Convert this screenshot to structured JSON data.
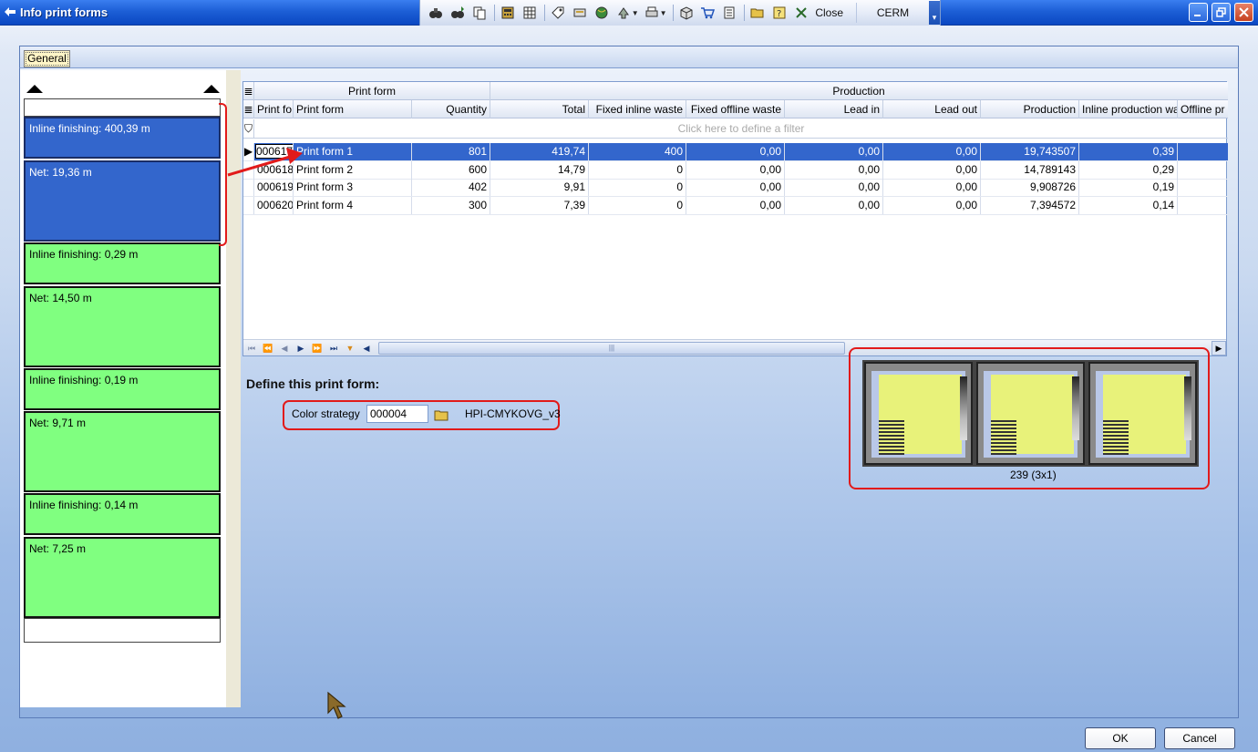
{
  "window": {
    "title": "Info print forms",
    "close_label": "Close",
    "cerm_label": "CERM"
  },
  "toolbar_icons": [
    "binoculars-icon",
    "find-next-icon",
    "copy-icon",
    "calculator-icon",
    "grid-icon",
    "tag-icon",
    "scanner-icon",
    "globe-icon",
    "export-icon",
    "print-icon",
    "box-icon",
    "cart-icon",
    "book-icon",
    "open-folder-icon",
    "help-icon",
    "close-icon"
  ],
  "tabs": [
    {
      "label": "General"
    }
  ],
  "left_panel": {
    "segments": [
      {
        "inline": "Inline finishing: 400,39 m",
        "net": "Net: 19,36 m",
        "color": "#3366cc"
      },
      {
        "inline": "Inline finishing: 0,29 m",
        "net": "Net: 14,50 m",
        "color": "#80ff80"
      },
      {
        "inline": "Inline finishing: 0,19 m",
        "net": "Net: 9,71 m",
        "color": "#80ff80"
      },
      {
        "inline": "Inline finishing: 0,14 m",
        "net": "Net: 7,25 m",
        "color": "#80ff80"
      }
    ]
  },
  "grid": {
    "bands": {
      "print_form": "Print form",
      "production": "Production"
    },
    "columns": [
      "Print fo",
      "Print form",
      "Quantity",
      "Total",
      "Fixed inline waste",
      "Fixed offline waste",
      "Lead in",
      "Lead out",
      "Production",
      "Inline production wa",
      "Offline pr"
    ],
    "filter_hint": "Click here to define a filter",
    "rows": [
      {
        "id": "000617",
        "name": "Print form 1",
        "quantity": "801",
        "total": "419,74",
        "fixed_inline": "400",
        "fixed_offline": "0,00",
        "lead_in": "0,00",
        "lead_out": "0,00",
        "production": "19,743507",
        "inline_prod": "0,39",
        "offline": ""
      },
      {
        "id": "000618",
        "name": "Print form 2",
        "quantity": "600",
        "total": "14,79",
        "fixed_inline": "0",
        "fixed_offline": "0,00",
        "lead_in": "0,00",
        "lead_out": "0,00",
        "production": "14,789143",
        "inline_prod": "0,29",
        "offline": ""
      },
      {
        "id": "000619",
        "name": "Print form 3",
        "quantity": "402",
        "total": "9,91",
        "fixed_inline": "0",
        "fixed_offline": "0,00",
        "lead_in": "0,00",
        "lead_out": "0,00",
        "production": "9,908726",
        "inline_prod": "0,19",
        "offline": ""
      },
      {
        "id": "000620",
        "name": "Print form 4",
        "quantity": "300",
        "total": "7,39",
        "fixed_inline": "0",
        "fixed_offline": "0,00",
        "lead_in": "0,00",
        "lead_out": "0,00",
        "production": "7,394572",
        "inline_prod": "0,14",
        "offline": ""
      }
    ]
  },
  "define": {
    "heading": "Define this print form:",
    "color_strategy_label": "Color strategy",
    "color_strategy_value": "000004",
    "color_strategy_name": "HPI-CMYKOVG_v3"
  },
  "preview": {
    "caption": "239 (3x1)"
  },
  "buttons": {
    "ok": "OK",
    "cancel": "Cancel"
  },
  "colors": {
    "selection": "#3366cc",
    "segment_green": "#80ff80",
    "annotation_red": "#e21a1a"
  }
}
